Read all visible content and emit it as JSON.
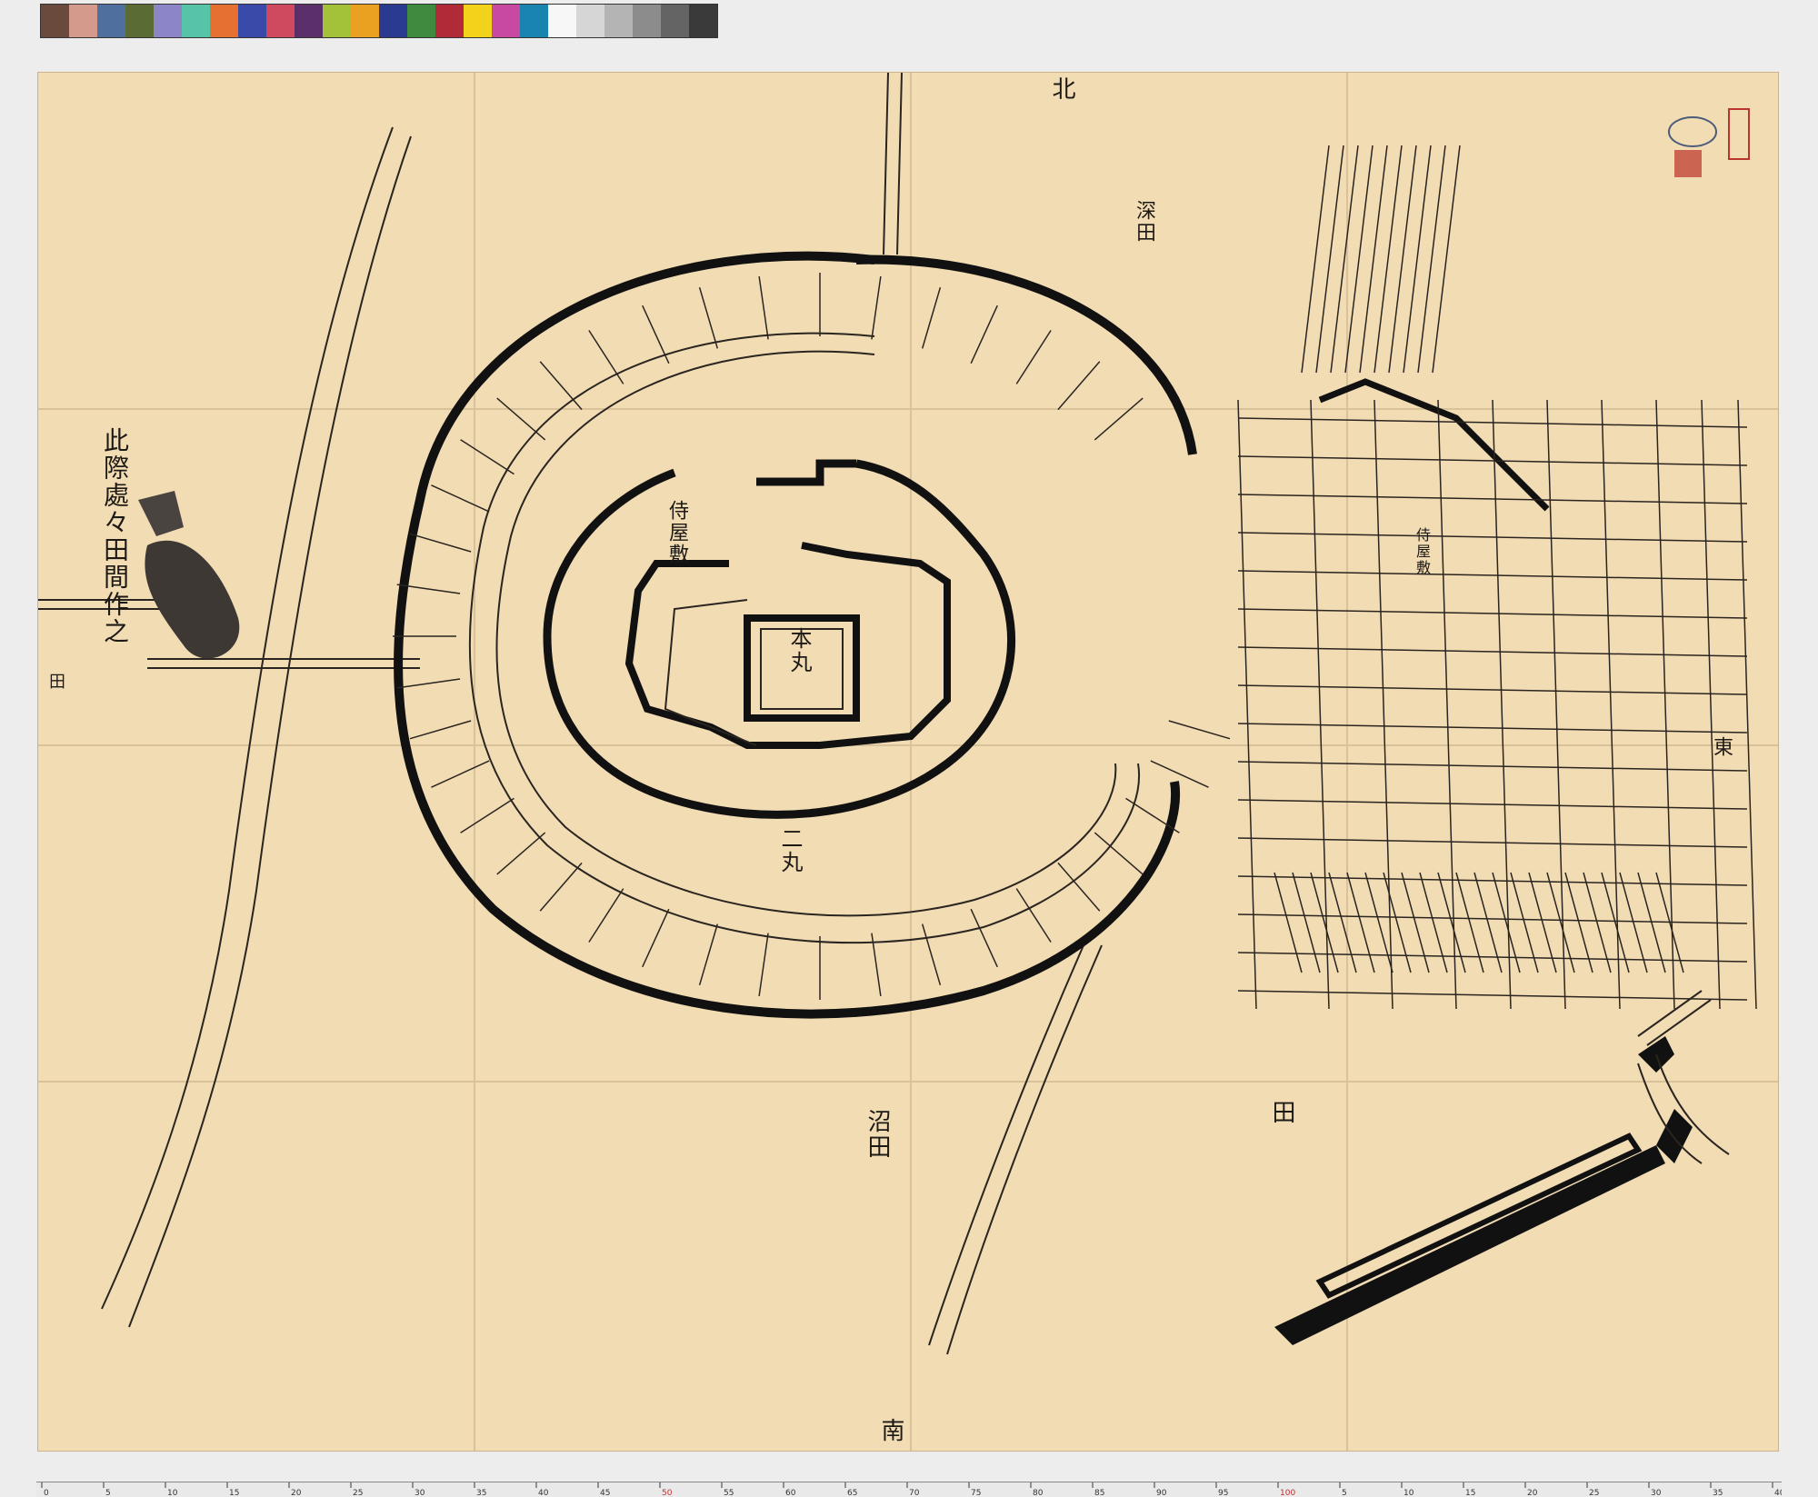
{
  "colorbar": {
    "swatches": [
      "#6a4a3c",
      "#d49a8c",
      "#4f6f9f",
      "#5b6b34",
      "#8c86c6",
      "#57c4a8",
      "#e57031",
      "#3a4aa8",
      "#cf4a5e",
      "#5a2f6a",
      "#a3c23a",
      "#eaa020",
      "#2a3a90",
      "#3e8a3e",
      "#b02a38",
      "#f2d21a",
      "#c84aa0",
      "#1a84b0",
      "#f7f7f7",
      "#d6d6d6",
      "#b4b4b4",
      "#8c8c8c",
      "#646464",
      "#3a3a3a"
    ]
  },
  "map": {
    "west_note": "此際處々田間作之",
    "inner_bailey": "本丸",
    "second_bailey": "二丸",
    "samurai_houses": "侍屋敷",
    "field_symbol": "田",
    "north": "北",
    "south": "南",
    "east": "東",
    "field_label_south": "沼田",
    "field_label_north": "深田"
  },
  "ruler": {
    "ticks": [
      "0",
      "5",
      "10",
      "15",
      "20",
      "25",
      "30",
      "35",
      "40",
      "45",
      "50",
      "55",
      "60",
      "65",
      "70",
      "75",
      "80",
      "85",
      "90",
      "95",
      "100",
      "5",
      "10",
      "15",
      "20",
      "25",
      "30",
      "35",
      "40"
    ]
  }
}
